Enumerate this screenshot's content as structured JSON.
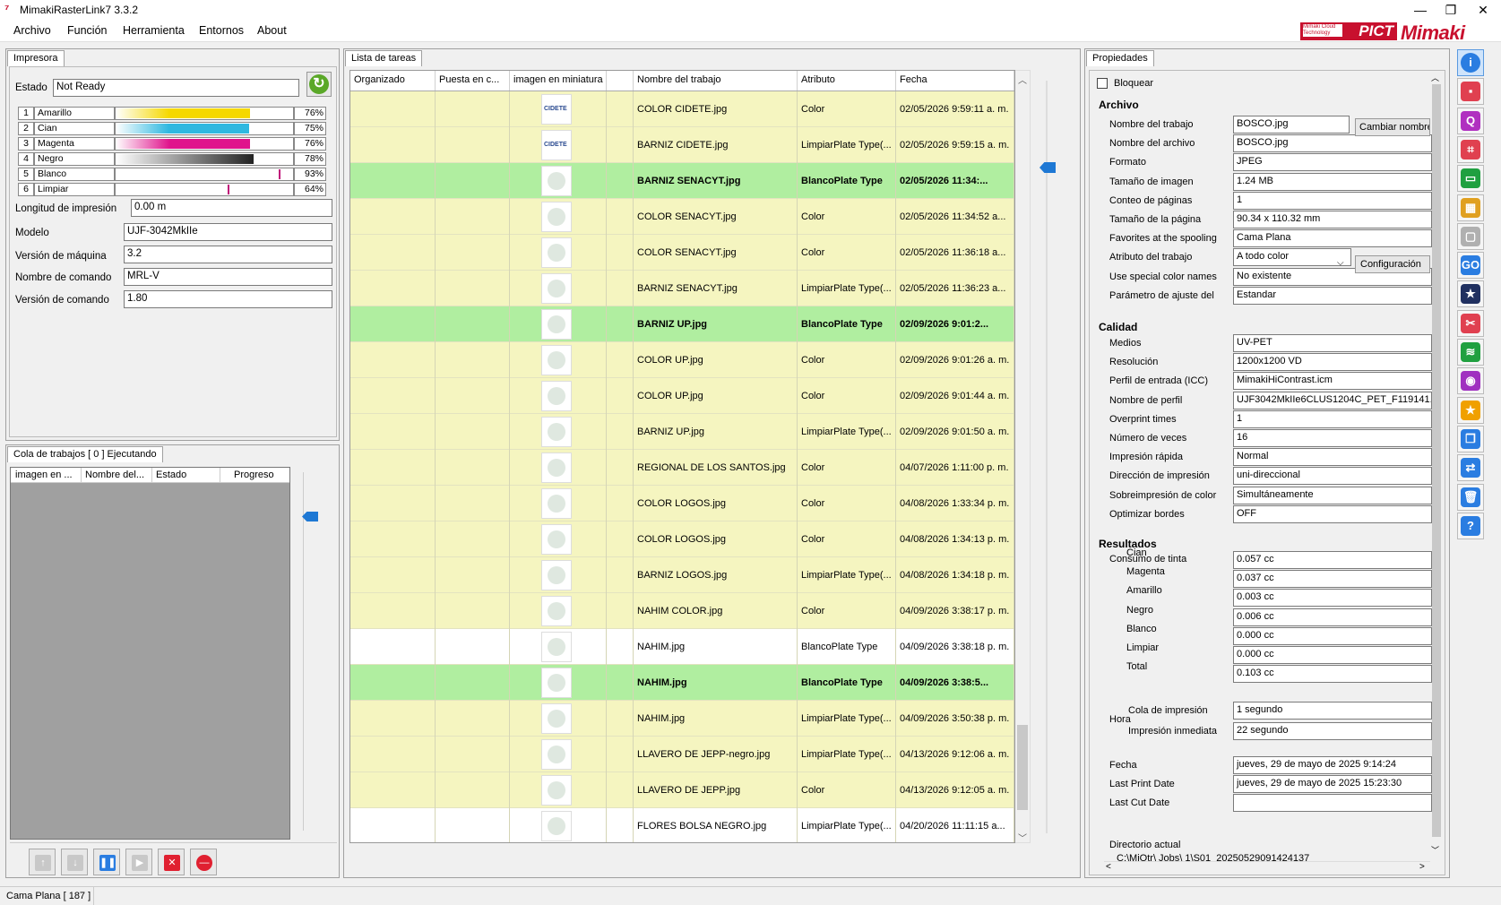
{
  "window": {
    "title": "MimakiRasterLink7 3.3.2",
    "controls": [
      "—",
      "❐",
      "✕"
    ]
  },
  "menu": [
    "Archivo",
    "Función",
    "Herramienta",
    "Entornos",
    "About"
  ],
  "brand": {
    "pict_small": "Mimaki Cloud Technology",
    "pict": "PICT",
    "mimaki": "Mimaki"
  },
  "printer": {
    "tab": "Impresora",
    "estado_label": "Estado",
    "estado": "Not Ready",
    "inks": [
      {
        "num": "1",
        "name": "Amarillo",
        "pct": "76%",
        "level": 0.76,
        "color": "#f5d800"
      },
      {
        "num": "2",
        "name": "Cian",
        "pct": "75%",
        "level": 0.75,
        "color": "#2fb8e0"
      },
      {
        "num": "3",
        "name": "Magenta",
        "pct": "76%",
        "level": 0.76,
        "color": "#e0148c"
      },
      {
        "num": "4",
        "name": "Negro",
        "pct": "78%",
        "level": 0.78,
        "color": "#222222"
      },
      {
        "num": "5",
        "name": "Blanco",
        "pct": "93%",
        "level": 0.93,
        "color": "#ffffff"
      },
      {
        "num": "6",
        "name": "Limpiar",
        "pct": "64%",
        "level": 0.64,
        "color": "#ffffff"
      }
    ],
    "longitud_label": "Longitud de impresión",
    "longitud": "0.00 m",
    "modelo_label": "Modelo",
    "modelo": "UJF-3042MkIIe",
    "version_label": "Versión de máquina",
    "version": "3.2",
    "comando_label": "Nombre de comando",
    "comando": "MRL-V",
    "vcomando_label": "Versión de comando",
    "vcomando": "1.80"
  },
  "queue": {
    "tab": "Cola de trabajos [ 0 ] Ejecutando",
    "headers": [
      "imagen en ...",
      "Nombre del...",
      "Estado",
      "Progreso"
    ]
  },
  "tasks": {
    "tab": "Lista de tareas",
    "headers": [
      "Organizado",
      "Puesta en c...",
      "imagen en miniatura",
      "",
      "Nombre del trabajo",
      "Atributo",
      "Fecha"
    ],
    "rows": [
      {
        "name": "COLOR CIDETE.jpg",
        "attr": "Color",
        "date": "02/05/2026 9:59:11 a. m.",
        "bg": "#f5f5c0",
        "bold": false,
        "thumb": "CIDETE"
      },
      {
        "name": "BARNIZ CIDETE.jpg",
        "attr": "LimpiarPlate Type(...",
        "date": "02/05/2026 9:59:15 a. m.",
        "bg": "#f5f5c0",
        "bold": false,
        "thumb": "CIDETE"
      },
      {
        "name": "BARNIZ SENACYT.jpg",
        "attr": "BlancoPlate Type",
        "date": "02/05/2026 11:34:...",
        "bg": "#b0eea0",
        "bold": true,
        "thumb": ""
      },
      {
        "name": "COLOR SENACYT.jpg",
        "attr": "Color",
        "date": "02/05/2026 11:34:52 a...",
        "bg": "#f5f5c0",
        "bold": false,
        "thumb": ""
      },
      {
        "name": "COLOR SENACYT.jpg",
        "attr": "Color",
        "date": "02/05/2026 11:36:18 a...",
        "bg": "#f5f5c0",
        "bold": false,
        "thumb": ""
      },
      {
        "name": "BARNIZ SENACYT.jpg",
        "attr": "LimpiarPlate Type(...",
        "date": "02/05/2026 11:36:23 a...",
        "bg": "#f5f5c0",
        "bold": false,
        "thumb": ""
      },
      {
        "name": "BARNIZ UP.jpg",
        "attr": "BlancoPlate Type",
        "date": "02/09/2026 9:01:2...",
        "bg": "#b0eea0",
        "bold": true,
        "thumb": ""
      },
      {
        "name": "COLOR UP.jpg",
        "attr": "Color",
        "date": "02/09/2026 9:01:26 a. m.",
        "bg": "#f5f5c0",
        "bold": false,
        "thumb": ""
      },
      {
        "name": "COLOR UP.jpg",
        "attr": "Color",
        "date": "02/09/2026 9:01:44 a. m.",
        "bg": "#f5f5c0",
        "bold": false,
        "thumb": ""
      },
      {
        "name": "BARNIZ UP.jpg",
        "attr": "LimpiarPlate Type(...",
        "date": "02/09/2026 9:01:50 a. m.",
        "bg": "#f5f5c0",
        "bold": false,
        "thumb": ""
      },
      {
        "name": "REGIONAL DE LOS SANTOS.jpg",
        "attr": "Color",
        "date": "04/07/2026 1:11:00 p. m.",
        "bg": "#f5f5c0",
        "bold": false,
        "thumb": ""
      },
      {
        "name": "COLOR LOGOS.jpg",
        "attr": "Color",
        "date": "04/08/2026 1:33:34 p. m.",
        "bg": "#f5f5c0",
        "bold": false,
        "thumb": ""
      },
      {
        "name": "COLOR LOGOS.jpg",
        "attr": "Color",
        "date": "04/08/2026 1:34:13 p. m.",
        "bg": "#f5f5c0",
        "bold": false,
        "thumb": ""
      },
      {
        "name": "BARNIZ LOGOS.jpg",
        "attr": "LimpiarPlate Type(...",
        "date": "04/08/2026 1:34:18 p. m.",
        "bg": "#f5f5c0",
        "bold": false,
        "thumb": ""
      },
      {
        "name": "NAHIM COLOR.jpg",
        "attr": "Color",
        "date": "04/09/2026 3:38:17 p. m.",
        "bg": "#f5f5c0",
        "bold": false,
        "thumb": ""
      },
      {
        "name": "NAHIM.jpg",
        "attr": "BlancoPlate Type",
        "date": "04/09/2026 3:38:18 p. m.",
        "bg": "#ffffff",
        "bold": false,
        "thumb": ""
      },
      {
        "name": "NAHIM.jpg",
        "attr": "BlancoPlate Type",
        "date": "04/09/2026 3:38:5...",
        "bg": "#b0eea0",
        "bold": true,
        "thumb": ""
      },
      {
        "name": "NAHIM.jpg",
        "attr": "LimpiarPlate Type(...",
        "date": "04/09/2026 3:50:38 p. m.",
        "bg": "#f5f5c0",
        "bold": false,
        "thumb": ""
      },
      {
        "name": "LLAVERO DE JEPP-negro.jpg",
        "attr": "LimpiarPlate Type(...",
        "date": "04/13/2026 9:12:06 a. m.",
        "bg": "#f5f5c0",
        "bold": false,
        "thumb": ""
      },
      {
        "name": "LLAVERO DE JEPP.jpg",
        "attr": "Color",
        "date": "04/13/2026 9:12:05 a. m.",
        "bg": "#f5f5c0",
        "bold": false,
        "thumb": ""
      },
      {
        "name": "FLORES BOLSA NEGRO.jpg",
        "attr": "LimpiarPlate Type(...",
        "date": "04/20/2026 11:11:15 a...",
        "bg": "#ffffff",
        "bold": false,
        "thumb": ""
      }
    ]
  },
  "props": {
    "tab": "Propiedades",
    "bloquear": "Bloquear",
    "archivo": "Archivo",
    "cambiar_nombre": "Cambiar nombre",
    "configuracion": "Configuración",
    "archivo_fields": [
      {
        "label": "Nombre del trabajo",
        "value": "BOSCO.jpg"
      },
      {
        "label": "Nombre del archivo",
        "value": "BOSCO.jpg"
      },
      {
        "label": "Formato",
        "value": "JPEG"
      },
      {
        "label": "Tamaño de imagen",
        "value": "1.24 MB"
      },
      {
        "label": "Conteo de páginas",
        "value": "1"
      },
      {
        "label": "Tamaño de la página",
        "value": "90.34 x 110.32 mm"
      },
      {
        "label": "Favorites at the spooling",
        "value": "Cama Plana"
      },
      {
        "label": "Atributo del trabajo",
        "value": "A todo color"
      },
      {
        "label": "Use special color names",
        "value": "No existente"
      },
      {
        "label": "Parámetro de ajuste del",
        "value": "Estandar"
      }
    ],
    "calidad": "Calidad",
    "calidad_fields": [
      {
        "label": "Medios",
        "value": "UV-PET"
      },
      {
        "label": "Resolución",
        "value": "1200x1200 VD"
      },
      {
        "label": "Perfil de entrada (ICC)",
        "value": "MimakiHiContrast.icm"
      },
      {
        "label": "Nombre de perfil",
        "value": "UJF3042MkIIe6CLUS1204C_PET_F119141.icc"
      },
      {
        "label": "Overprint times",
        "value": "1"
      },
      {
        "label": "Número de veces",
        "value": "16"
      },
      {
        "label": "Impresión rápida",
        "value": "Normal"
      },
      {
        "label": "Dirección de impresión",
        "value": "uni-direccional"
      },
      {
        "label": "Sobreimpresión de color",
        "value": "Simultáneamente"
      },
      {
        "label": "Optimizar bordes",
        "value": "OFF"
      }
    ],
    "resultados": "Resultados",
    "consumo": "Consumo de tinta",
    "consumo_fields": [
      {
        "label": "Cian",
        "value": "0.057 cc"
      },
      {
        "label": "Magenta",
        "value": "0.037 cc"
      },
      {
        "label": "Amarillo",
        "value": "0.003 cc"
      },
      {
        "label": "Negro",
        "value": "0.006 cc"
      },
      {
        "label": "Blanco",
        "value": "0.000 cc"
      },
      {
        "label": "Limpiar",
        "value": "0.000 cc"
      },
      {
        "label": "Total",
        "value": "0.103 cc"
      }
    ],
    "hora": "Hora",
    "hora_fields": [
      {
        "label": "Cola de impresión",
        "value": "1 segundo"
      },
      {
        "label": "Impresión inmediata",
        "value": "22 segundo"
      }
    ],
    "fecha_fields": [
      {
        "label": "Fecha",
        "value": "jueves, 29 de mayo de 2025 9:14:24"
      },
      {
        "label": "Last Print Date",
        "value": "jueves, 29 de mayo de 2025 15:23:30"
      },
      {
        "label": "Last Cut Date",
        "value": ""
      }
    ],
    "directorio_label": "Directorio actual",
    "directorio": "C:\\MiOtr\\ Jobs\\ 1\\S01_20250529091424137"
  },
  "sidebar_icons": [
    {
      "name": "info-icon",
      "glyph": "i",
      "color": "#2a7de1"
    },
    {
      "name": "print-settings-icon",
      "glyph": "▪",
      "color": "#e04050"
    },
    {
      "name": "quality-icon",
      "glyph": "Q",
      "color": "#b030c0"
    },
    {
      "name": "crop-icon",
      "glyph": "⌗",
      "color": "#e04050"
    },
    {
      "name": "layout-icon",
      "glyph": "▭",
      "color": "#20a040"
    },
    {
      "name": "tile-icon",
      "glyph": "▦",
      "color": "#e0a020"
    },
    {
      "name": "copy-disabled-icon",
      "glyph": "▢",
      "color": "#b0b0b0"
    },
    {
      "name": "go-icon",
      "glyph": "GO",
      "color": "#2a7de1"
    },
    {
      "name": "special-color-icon",
      "glyph": "★",
      "color": "#203060"
    },
    {
      "name": "cut-icon",
      "glyph": "✂",
      "color": "#e04050"
    },
    {
      "name": "layers-icon",
      "glyph": "≋",
      "color": "#20a040"
    },
    {
      "name": "color-wheel-icon",
      "glyph": "◉",
      "color": "#a030c0"
    },
    {
      "name": "favorite-icon",
      "glyph": "★",
      "color": "#f0a000"
    },
    {
      "name": "duplicate-icon",
      "glyph": "❐",
      "color": "#2a7de1"
    },
    {
      "name": "merge-icon",
      "glyph": "⇄",
      "color": "#2a7de1"
    },
    {
      "name": "delete-icon",
      "glyph": "🗑",
      "color": "#2a7de1"
    },
    {
      "name": "help-icon",
      "glyph": "?",
      "color": "#2a7de1"
    }
  ],
  "queue_buttons": [
    {
      "name": "move-up-button",
      "glyph": "↑",
      "color": "#c8c8c8"
    },
    {
      "name": "move-down-button",
      "glyph": "↓",
      "color": "#c8c8c8"
    },
    {
      "name": "pause-button",
      "glyph": "❚❚",
      "color": "#2a7de1"
    },
    {
      "name": "play-button",
      "glyph": "▶",
      "color": "#c8c8c8"
    },
    {
      "name": "cancel-job-button",
      "glyph": "✕",
      "color": "#e02030"
    },
    {
      "name": "stop-button",
      "glyph": "—",
      "color": "#e02030"
    }
  ],
  "status": {
    "text": "Cama Plana [ 187 ]"
  }
}
